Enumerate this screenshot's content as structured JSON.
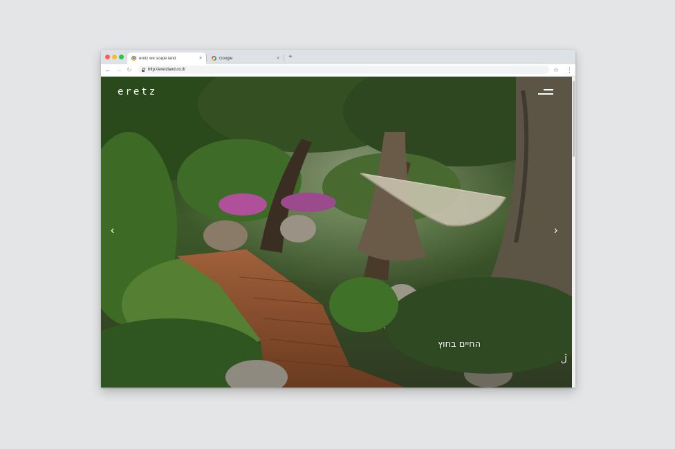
{
  "browser": {
    "tabs": [
      {
        "title": "eretz we scape land",
        "icon": "chrome-icon",
        "active": true
      },
      {
        "title": "Google",
        "icon": "google-icon",
        "active": false
      }
    ],
    "close_glyph": "×",
    "new_tab_glyph": "+",
    "url": "http://eretzland.co.il/",
    "back_glyph": "←",
    "forward_glyph": "→",
    "reload_glyph": "↻",
    "star_glyph": "☆",
    "menu_glyph": "⋮"
  },
  "site": {
    "logo": "eretz",
    "prev_glyph": "‹",
    "next_glyph": "›",
    "tagline": "החיים בחוץ",
    "corner_glyph": "ڷ"
  }
}
